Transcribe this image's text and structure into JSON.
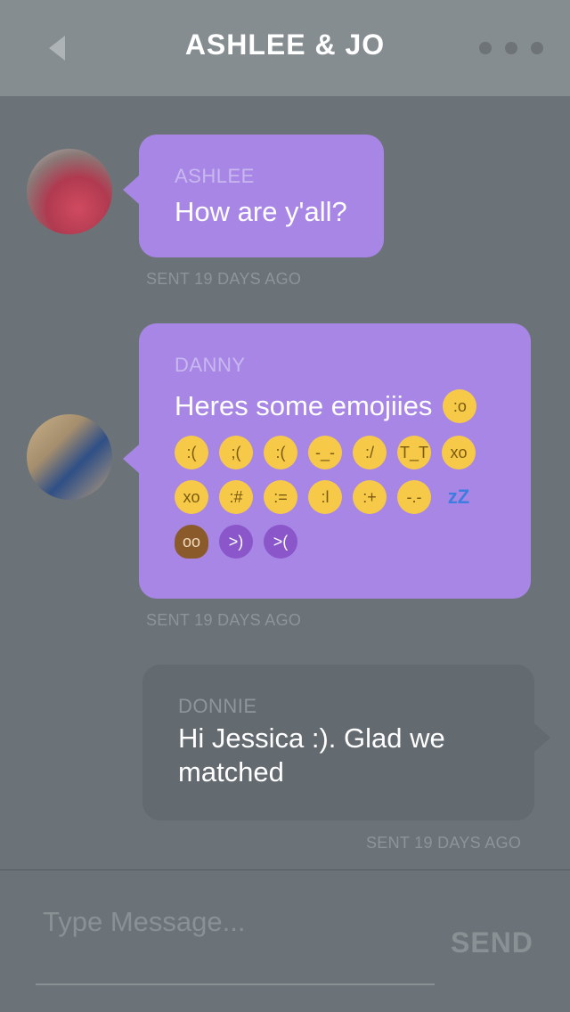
{
  "header": {
    "title": "ASHLEE & JO",
    "back_icon": "chevron-left-icon",
    "more_icon": "more-horizontal-icon"
  },
  "messages": [
    {
      "sender": "ASHLEE",
      "text": "How are y'all?",
      "sent": "SENT 19 DAYS AGO",
      "avatar": "avatar-photo"
    },
    {
      "sender": "DANNY",
      "text": "Heres some emojiies",
      "sent": "SENT 19 DAYS AGO",
      "avatar": "avatar-photo",
      "emoji_rows": [
        [
          "frowning-open-mouth"
        ],
        [
          "hushed",
          "crying",
          "frowning",
          "sleepy",
          "cold-sweat",
          "loudly-crying",
          "dizzy"
        ],
        [
          "dizzy",
          "zipper-mouth",
          "medical-mask",
          "thermometer",
          "bandage",
          "sleeping",
          "zzz"
        ],
        [
          "pile-of-poo",
          "smiling-devil",
          "angry-devil"
        ]
      ]
    },
    {
      "sender": "DONNIE",
      "text": "Hi Jessica :). Glad we matched",
      "sent": "SENT 19 DAYS AGO"
    }
  ],
  "compose": {
    "placeholder": "Type Message...",
    "value": "",
    "send_label": "SEND"
  },
  "colors": {
    "background": "#6b7378",
    "header": "#858d90",
    "purple_bubble": "#a786e6",
    "grey_bubble": "#646b70",
    "emoji": "#f7c948"
  }
}
